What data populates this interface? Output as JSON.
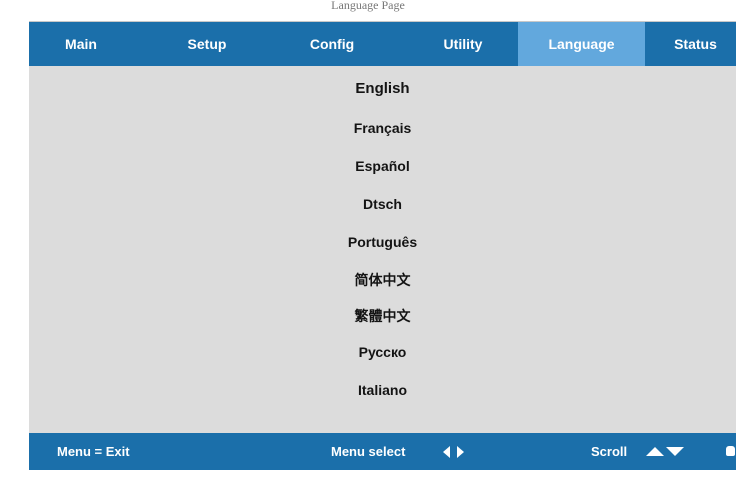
{
  "top_caption": "Language Page",
  "tabs": [
    {
      "label": "Main",
      "active": false
    },
    {
      "label": "Setup",
      "active": false
    },
    {
      "label": "Config",
      "active": false
    },
    {
      "label": "Utility",
      "active": false
    },
    {
      "label": "Language",
      "active": true
    },
    {
      "label": "Status",
      "active": false
    }
  ],
  "languages": [
    "English",
    "Français",
    "Español",
    "Dtsch",
    "Português",
    "简体中文",
    "繁體中文",
    "Русско",
    "Italiano"
  ],
  "footer": {
    "exit_label": "Menu = Exit",
    "select_label": "Menu select",
    "scroll_label": "Scroll"
  },
  "colors": {
    "tab_bar": "#1b6faa",
    "active_tab": "#62a8dd",
    "panel_bg": "#dcdcdc",
    "text_on_bar": "#ffffff"
  },
  "icons": {
    "select_arrows": "left-right-arrow-icon",
    "scroll_arrows": "up-down-arrow-icon"
  }
}
